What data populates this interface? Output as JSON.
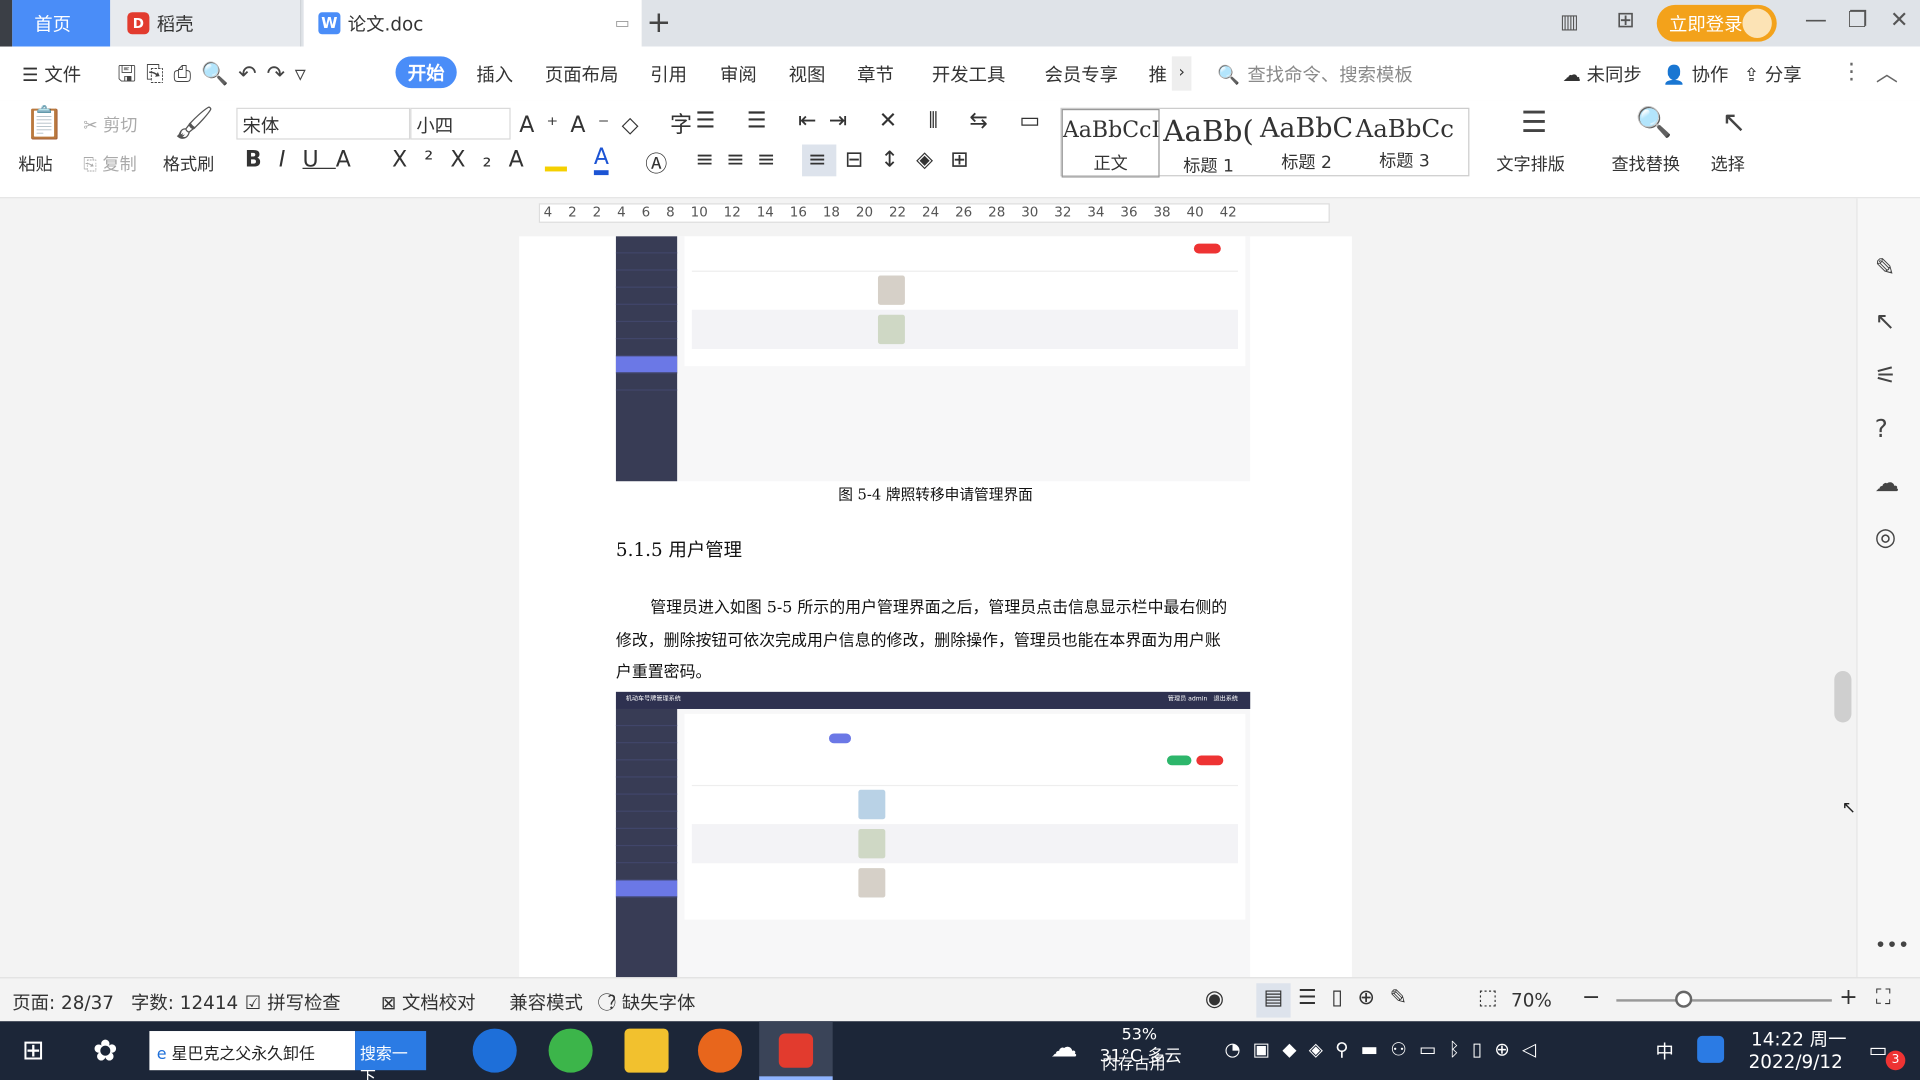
{
  "tabs": {
    "home": "首页",
    "daoke": "稻壳",
    "doc": "论文.doc"
  },
  "titlebar": {
    "login": "立即登录"
  },
  "menu": {
    "file": "文件",
    "items": [
      "开始",
      "插入",
      "页面布局",
      "引用",
      "审阅",
      "视图",
      "章节",
      "开发工具",
      "会员专享",
      "推"
    ],
    "search_placeholder": "查找命令、搜索模板",
    "sync": "未同步",
    "collab": "协作",
    "share": "分享"
  },
  "ribbon": {
    "paste": "粘贴",
    "cut": "剪切",
    "copy": "复制",
    "format_painter": "格式刷",
    "font": "宋体",
    "size": "小四",
    "styles": [
      {
        "preview": "AaBbCcI",
        "name": "正文"
      },
      {
        "preview": "AaBb(",
        "name": "标题 1"
      },
      {
        "preview": "AaBbC",
        "name": "标题 2"
      },
      {
        "preview": "AaBbCc",
        "name": "标题 3"
      }
    ],
    "text_layout": "文字排版",
    "find_replace": "查找替换",
    "select": "选择"
  },
  "ruler": {
    "marks": [
      "4",
      "2",
      "2",
      "4",
      "6",
      "8",
      "10",
      "12",
      "14",
      "16",
      "18",
      "20",
      "22",
      "24",
      "26",
      "28",
      "30",
      "32",
      "34",
      "36",
      "38",
      "40",
      "42"
    ]
  },
  "document": {
    "caption": "图 5-4 牌照转移申请管理界面",
    "heading": "5.1.5 用户管理",
    "para_lines": [
      "管理员进入如图 5-5 所示的用户管理界面之后，管理员点击信息显示栏中最右侧的",
      "修改，删除按钮可依次完成用户信息的修改，删除操作，管理员也能在本界面为用户账",
      "户重置密码。"
    ],
    "shot2_title": "机动车号牌管理系统",
    "shot2_user": "管理员 admin　退出系统"
  },
  "status": {
    "page": "页面: 28/37",
    "words": "字数: 12414",
    "spell": "拼写检查",
    "proof": "文档校对",
    "compat": "兼容模式",
    "missing_font": "缺失字体",
    "zoom": "70%"
  },
  "taskbar": {
    "search_text": "星巴克之父永久卸任",
    "search_btn": "搜索一下",
    "weather_temp": "31°C 多云",
    "mem_pct": "53%",
    "mem_label": "内存占用",
    "ime": "中",
    "time": "14:22 周一",
    "date": "2022/9/12",
    "notif_count": "3"
  }
}
